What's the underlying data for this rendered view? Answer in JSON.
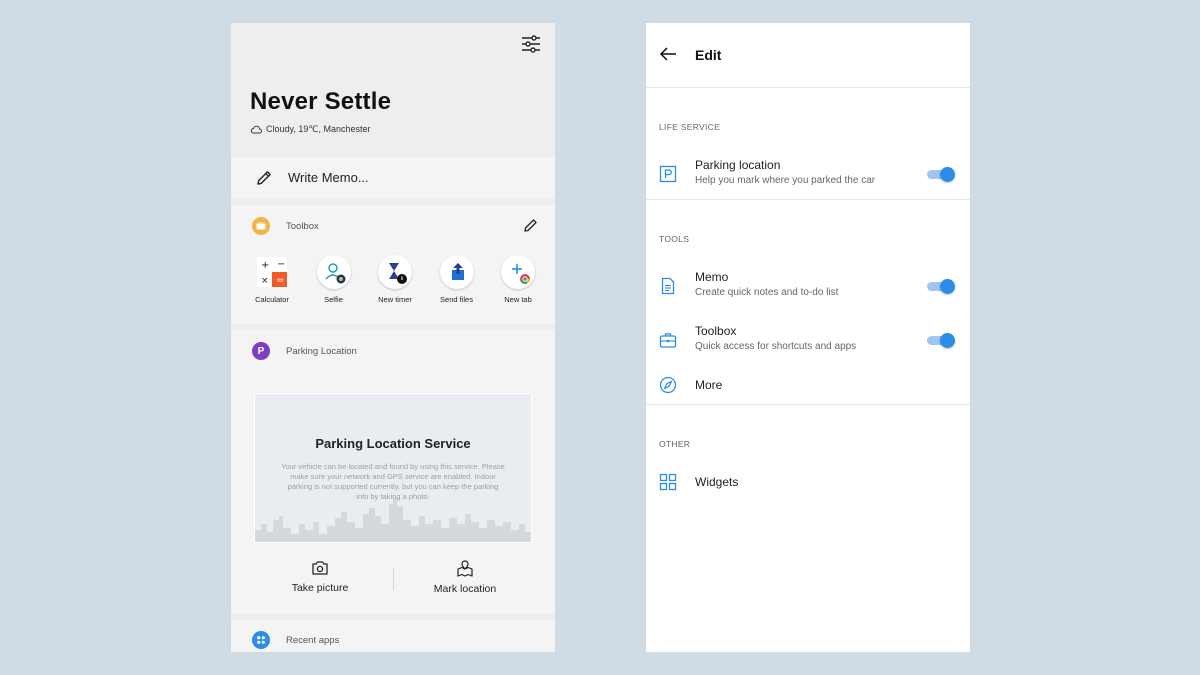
{
  "colors": {
    "background": "#d0dbe3",
    "accent_blue": "#2b8de6",
    "toolbox_orange": "#f5b447",
    "parking_purple": "#7b3fbf",
    "recent_blue": "#2b8de6"
  },
  "left": {
    "title": "Never Settle",
    "weather": "Cloudy, 19℃, Manchester",
    "weather_icon": "cloud-icon",
    "filter_icon": "sliders-icon",
    "memo": {
      "label": "Write Memo...",
      "icon": "pencil-icon"
    },
    "toolbox": {
      "label": "Toolbox",
      "items": [
        {
          "label": "Calculator",
          "icon": "calculator-icon"
        },
        {
          "label": "Selfie",
          "icon": "selfie-icon"
        },
        {
          "label": "New timer",
          "icon": "hourglass-icon"
        },
        {
          "label": "Send files",
          "icon": "send-files-icon"
        },
        {
          "label": "New tab",
          "icon": "new-tab-icon"
        }
      ]
    },
    "parking": {
      "badge": "P",
      "label": "Parking Location",
      "title": "Parking Location Service",
      "description": "Your vehicle can be located and found by using this service. Please make sure your network and GPS service are enabled. Indoor parking is not supported currently, but you can keep the parking info by taking a photo.",
      "take_picture": "Take picture",
      "mark_location": "Mark location"
    },
    "recent": {
      "label": "Recent apps"
    }
  },
  "right": {
    "title": "Edit",
    "sections": {
      "life_service": "LIFE SERVICE",
      "tools": "TOOLS",
      "other": "OTHER"
    },
    "parking": {
      "title": "Parking location",
      "subtitle": "Help you mark where you parked the car",
      "enabled": true
    },
    "memo": {
      "title": "Memo",
      "subtitle": "Create quick notes and to-do list",
      "enabled": true
    },
    "toolbox": {
      "title": "Toolbox",
      "subtitle": "Quick access for shortcuts and apps",
      "enabled": true
    },
    "more": {
      "title": "More"
    },
    "widgets": {
      "title": "Widgets"
    }
  }
}
